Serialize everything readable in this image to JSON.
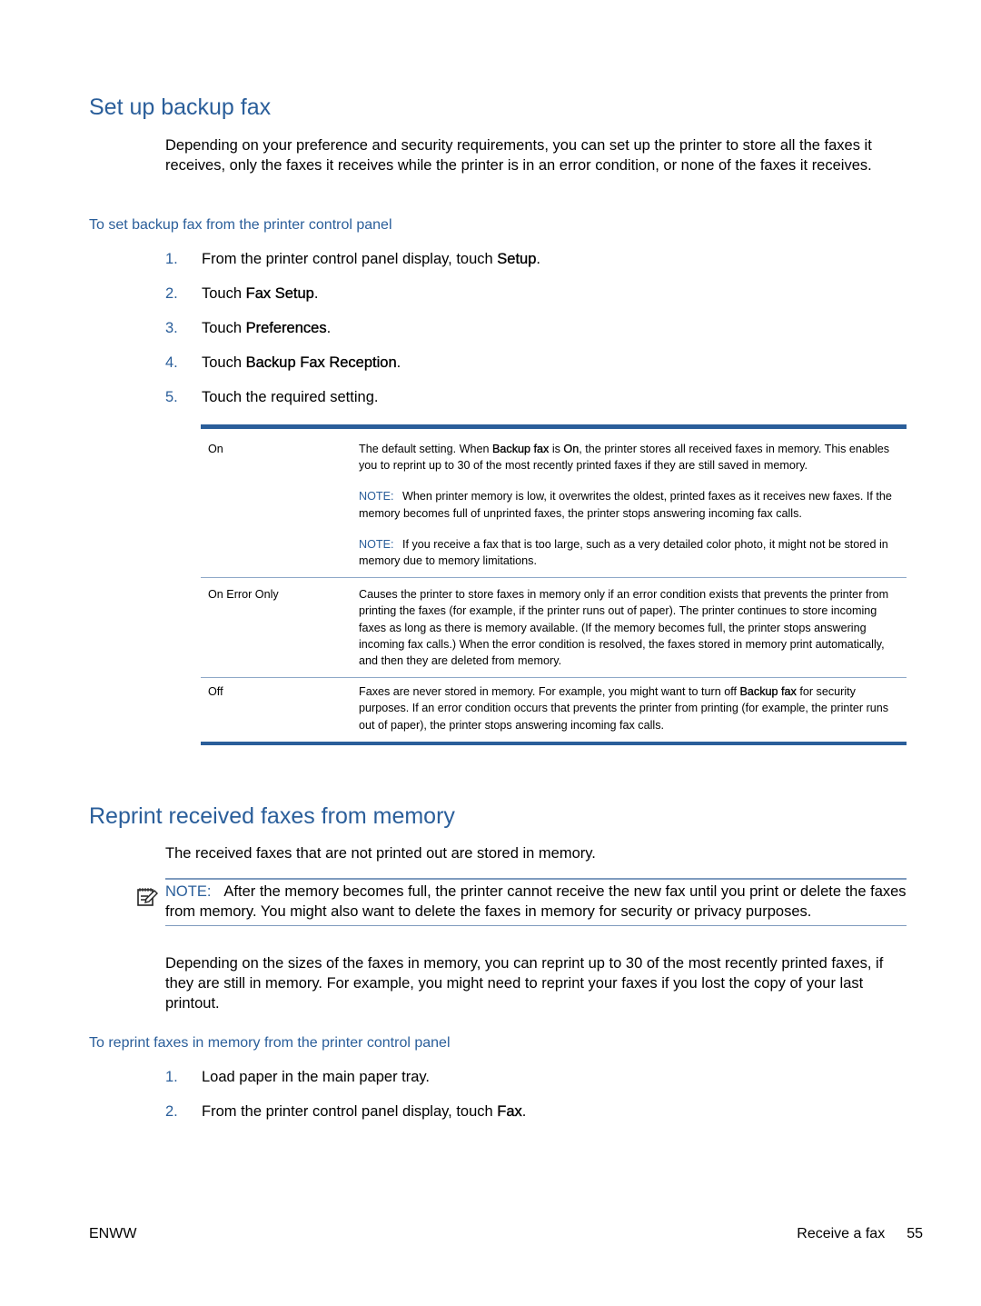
{
  "section1": {
    "title": "Set up backup fax",
    "intro": "Depending on your preference and security requirements, you can set up the printer to store all the faxes it receives, only the faxes it receives while the printer is in an error condition, or none of the faxes it receives.",
    "procedure_title": "To set backup fax from the printer control panel",
    "steps": [
      {
        "num": "1.",
        "pre": "From the printer control panel display, touch ",
        "bold": "Setup",
        "post": "."
      },
      {
        "num": "2.",
        "pre": "Touch ",
        "bold": "Fax Setup",
        "post": "."
      },
      {
        "num": "3.",
        "pre": "Touch ",
        "bold": "Preferences",
        "post": "."
      },
      {
        "num": "4.",
        "pre": "Touch ",
        "bold": "Backup Fax Reception",
        "post": "."
      },
      {
        "num": "5.",
        "pre": "Touch the required setting.",
        "bold": "",
        "post": ""
      }
    ],
    "table": {
      "rows": [
        {
          "term": "On",
          "desc_parts": {
            "a": "The default setting. When ",
            "b": "Backup fax",
            "c": " is ",
            "d": "On",
            "e": ", the printer stores all received faxes in memory. This enables you to reprint up to 30 of the most recently printed faxes if they are still saved in memory."
          },
          "notes": [
            {
              "label": "NOTE:",
              "text": "When printer memory is low, it overwrites the oldest, printed faxes as it receives new faxes. If the memory becomes full of unprinted faxes, the printer stops answering incoming fax calls."
            },
            {
              "label": "NOTE:",
              "text": "If you receive a fax that is too large, such as a very detailed color photo, it might not be stored in memory due to memory limitations."
            }
          ]
        },
        {
          "term": "On Error Only",
          "desc": "Causes the printer to store faxes in memory only if an error condition exists that prevents the printer from printing the faxes (for example, if the printer runs out of paper). The printer continues to store incoming faxes as long as there is memory available. (If the memory becomes full, the printer stops answering incoming fax calls.) When the error condition is resolved, the faxes stored in memory print automatically, and then they are deleted from memory."
        },
        {
          "term": "Off",
          "desc_parts": {
            "a": "Faxes are never stored in memory. For example, you might want to turn off ",
            "b": "Backup fax",
            "c": " for security purposes. If an error condition occurs that prevents the printer from printing (for example, the printer runs out of paper), the printer stops answering incoming fax calls."
          }
        }
      ]
    }
  },
  "section2": {
    "title": "Reprint received faxes from memory",
    "intro": "The received faxes that are not printed out are stored in memory.",
    "note": {
      "icon": "note-pad-icon",
      "label": "NOTE:",
      "text": "After the memory becomes full, the printer cannot receive the new fax until you print or delete the faxes from memory. You might also want to delete the faxes in memory for security or privacy purposes."
    },
    "para2": "Depending on the sizes of the faxes in memory, you can reprint up to 30 of the most recently printed faxes, if they are still in memory. For example, you might need to reprint your faxes if you lost the copy of your last printout.",
    "procedure_title": "To reprint faxes in memory from the printer control panel",
    "steps": [
      {
        "num": "1.",
        "pre": "Load paper in the main paper tray.",
        "bold": "",
        "post": ""
      },
      {
        "num": "2.",
        "pre": "From the printer control panel display, touch ",
        "bold": "Fax",
        "post": "."
      }
    ]
  },
  "footer": {
    "left": "ENWW",
    "section": "Receive a fax",
    "page": "55"
  },
  "colors": {
    "heading": "#2a5e9a",
    "rule": "#2a5e9a"
  }
}
